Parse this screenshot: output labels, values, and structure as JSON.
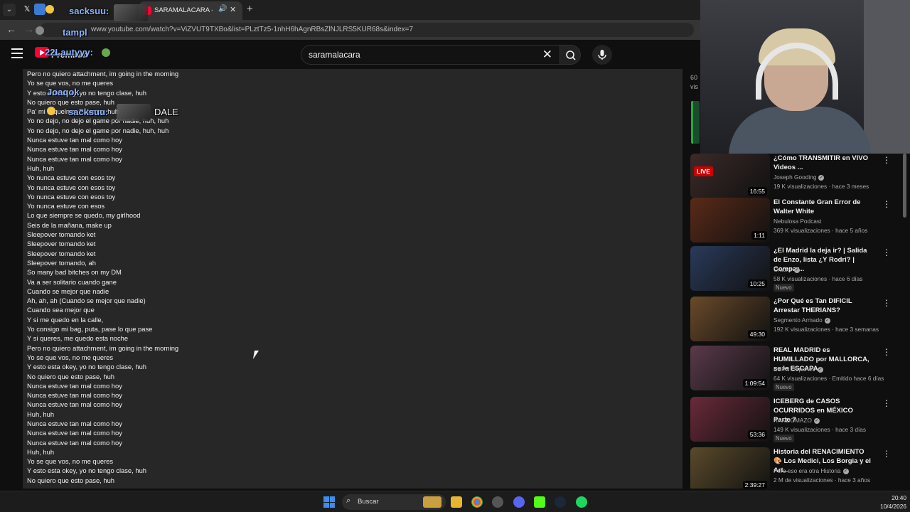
{
  "browser": {
    "active_tab_title": "SARAMALACARA - NO T",
    "url": "www.youtube.com/watch?v=ViZVUT9TXBo&list=PLztTz5-1nhH6hAgnRBsZlNJLRS5KUR68s&index=7"
  },
  "header": {
    "logo_text": "Premium",
    "search_value": "saramalacara"
  },
  "lyrics": [
    "Pero no quiero attachment, im going in the morning",
    "Yo se que vos, no me queres",
    "Y esto esta okey, yo no tengo clase, huh",
    "No quiero que esto pase, huh",
    "Pa' mi Riquelme, Palermo, huh",
    "Yo no dejo, no dejo el game por nadie, huh, huh",
    "Yo no dejo, no dejo el game por nadie, huh, huh",
    "Nunca estuve tan mal como hoy",
    "Nunca estuve tan mal como hoy",
    "Nunca estuve tan mal como hoy",
    "Huh, huh",
    "Yo nunca estuve con esos toy",
    "Yo nunca estuve con esos toy",
    "Yo nunca estuve con esos toy",
    "Yo nunca estuve con esos",
    "Lo que siempre se quedo, my girlhood",
    "Seis de la mañana, make up",
    "Sleepover tomando ket",
    "Sleepover tomando ket",
    "Sleepover tomando ket",
    "Sleepover tomando, ah",
    "So many bad bitches on my DM",
    "Va a ser solitario cuando gane",
    "Cuando se mejor que nadie",
    "Ah, ah, ah (Cuando se mejor que nadie)",
    "Cuando sea mejor que",
    "Y si me quedo en la calle,",
    "Yo consigo mi bag, puta, pase lo que pase",
    "Y si queres, me quedo esta noche",
    "Pero no quiero attachment, im going in the morning",
    "Yo se que vos, no me queres",
    "Y esto esta okey, yo no tengo clase, huh",
    "No quiero que esto pase, huh",
    "Nunca estuve tan mal como hoy",
    "Nunca estuve tan mal como hoy",
    "Nunca estuve tan mal como hoy",
    "Huh, huh",
    "Nunca estuve tan mal como hoy",
    "Nunca estuve tan mal como hoy",
    "Nunca estuve tan mal como hoy",
    "Huh, huh",
    "Yo se que vos, no me queres",
    "Y esto esta okey, yo no tengo clase, huh",
    "No quiero que esto pase, huh"
  ],
  "chat_overlays": {
    "user1": "sacksuu:",
    "user2": "tampl",
    "user3": "22Lautyyy:",
    "user4": "Joaqok",
    "user5": "sacksuu:",
    "message": "DALE"
  },
  "sidebar": {
    "views_fragment": "60",
    "views_fragment2": "vis",
    "recommendations": [
      {
        "title": "¿Cómo TRANSMITIR en VIVO Videos ...",
        "channel": "Joseph Gooding",
        "meta": "19 K visualizaciones · hace 3 meses",
        "duration": "16:55",
        "live": "LIVE",
        "badge": "",
        "verified": true,
        "thumb": "#3a2a28"
      },
      {
        "title": "El Constante Gran Error de Walter White",
        "channel": "Nebulosa Podcast",
        "meta": "369 K visualizaciones · hace 5 años",
        "duration": "1:11",
        "live": "",
        "badge": "",
        "verified": false,
        "thumb": "#5a2a18"
      },
      {
        "title": "¿El Madrid la deja ir? | Salida de Enzo, lista ¿Y Rodri? | Compar...",
        "channel": "Cracks",
        "meta": "58 K visualizaciones · hace 6 días",
        "duration": "10:25",
        "live": "",
        "badge": "Nuevo",
        "verified": true,
        "thumb": "#2a3a5a"
      },
      {
        "title": "¿Por Qué es Tan DIFICIL Arrestar THERIANS?",
        "channel": "Segmento Armado",
        "meta": "192 K visualizaciones · hace 3 semanas",
        "duration": "49:30",
        "live": "",
        "badge": "",
        "verified": true,
        "thumb": "#6a4a2a"
      },
      {
        "title": "REAL MADRID es HUMILLADO por MALLORCA, se le ESCAPA...",
        "channel": "ESPN Deportes",
        "meta": "64 K visualizaciones · Emitido hace 6 días",
        "duration": "1:09:54",
        "live": "",
        "badge": "Nuevo",
        "verified": true,
        "thumb": "#5a3a4a"
      },
      {
        "title": "ICEBERG de CASOS OCURRIDOS en MÉXICO Parte 7",
        "channel": "RANDOMAZO",
        "meta": "149 K visualizaciones · hace 3 días",
        "duration": "53:36",
        "live": "",
        "badge": "Nuevo",
        "verified": true,
        "thumb": "#6a2a3a"
      },
      {
        "title": "Historia del RENACIMIENTO 🎨 Los Medici, Los Borgia y el Art...",
        "channel": "Pero eso era otra Historia",
        "meta": "2 M de visualizaciones · hace 3 años",
        "duration": "2:39:27",
        "live": "",
        "badge": "",
        "verified": true,
        "thumb": "#5a4a2a"
      }
    ]
  },
  "taskbar": {
    "search_label": "Buscar",
    "time": "20:40",
    "date": "10/4/2026"
  },
  "colors": {
    "youtube_red": "#ff0033",
    "background": "#0f0f0f",
    "panel": "#272727"
  }
}
